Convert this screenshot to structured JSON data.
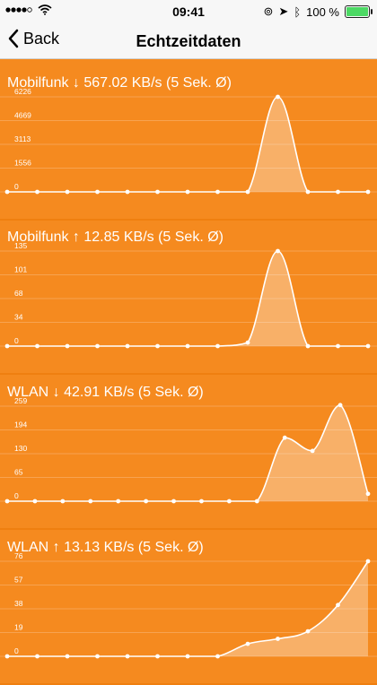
{
  "status_bar": {
    "time": "09:41",
    "battery": "100 %",
    "signal_icon": "signal-dots-icon",
    "wifi_icon": "wifi-icon"
  },
  "nav": {
    "back_label": "Back",
    "title": "Echtzeitdaten"
  },
  "colors": {
    "background": "#f58a1f",
    "accent": "#ffffff",
    "battery": "#4cd964"
  },
  "chart_data": [
    {
      "type": "area",
      "title": "Mobilfunk ↓ 567.02 KB/s (5 Sek. Ø)",
      "ylabels": [
        "6226",
        "4669",
        "3113",
        "1556",
        "0"
      ],
      "ylim": [
        0,
        6226
      ],
      "y": [
        0,
        0,
        0,
        0,
        0,
        0,
        0,
        0,
        0,
        6226,
        0,
        0,
        0
      ],
      "grid": true
    },
    {
      "type": "area",
      "title": "Mobilfunk ↑ 12.85 KB/s (5 Sek. Ø)",
      "ylabels": [
        "135",
        "101",
        "68",
        "34",
        "0"
      ],
      "ylim": [
        0,
        135
      ],
      "y": [
        0,
        0,
        0,
        0,
        0,
        0,
        0,
        0,
        5,
        135,
        0,
        0,
        0
      ],
      "grid": true
    },
    {
      "type": "area",
      "title": "WLAN ↓ 42.91 KB/s (5 Sek. Ø)",
      "ylabels": [
        "259",
        "194",
        "130",
        "65",
        "0"
      ],
      "ylim": [
        0,
        259
      ],
      "y": [
        0,
        0,
        0,
        0,
        0,
        0,
        0,
        0,
        0,
        0,
        173,
        137,
        262,
        20
      ],
      "grid": true
    },
    {
      "type": "area",
      "title": "WLAN ↑ 13.13 KB/s (5 Sek. Ø)",
      "ylabels": [
        "76",
        "57",
        "38",
        "19",
        "0"
      ],
      "ylim": [
        0,
        76
      ],
      "y": [
        0,
        0,
        0,
        0,
        0,
        0,
        0,
        0,
        10,
        14,
        20,
        41,
        76
      ],
      "grid": true
    }
  ]
}
